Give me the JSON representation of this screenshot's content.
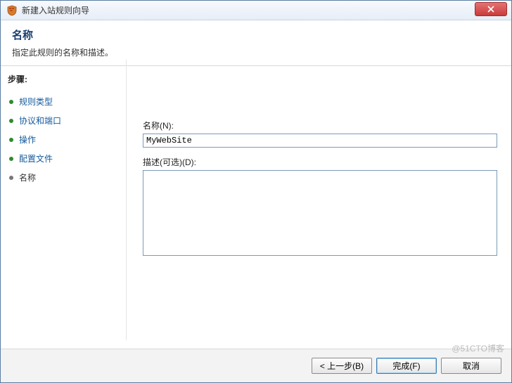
{
  "titlebar": {
    "title": "新建入站规则向导"
  },
  "header": {
    "title": "名称",
    "subtitle": "指定此规则的名称和描述。"
  },
  "sidebar": {
    "steps_label": "步骤:",
    "items": [
      {
        "label": "规则类型"
      },
      {
        "label": "协议和端口"
      },
      {
        "label": "操作"
      },
      {
        "label": "配置文件"
      },
      {
        "label": "名称"
      }
    ]
  },
  "form": {
    "name_label": "名称(N):",
    "name_value": "MyWebSite",
    "desc_label": "描述(可选)(D):",
    "desc_value": ""
  },
  "footer": {
    "back": "< 上一步(B)",
    "finish": "完成(F)",
    "cancel": "取消"
  },
  "watermark": "@51CTO博客"
}
